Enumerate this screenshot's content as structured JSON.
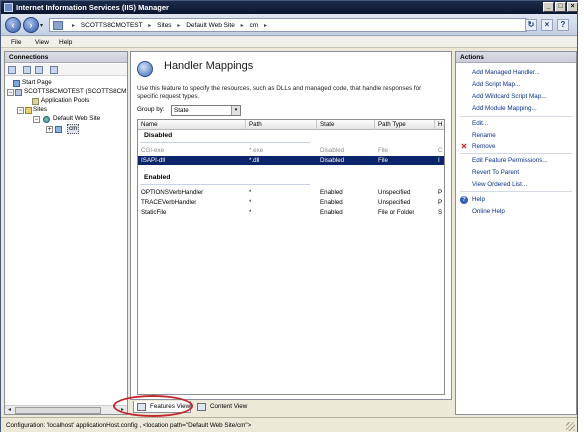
{
  "window": {
    "title": "Internet Information Services (IIS) Manager"
  },
  "address": {
    "crumbs": [
      "SCOTTS8CMOTEST",
      "Sites",
      "Default Web Site",
      "cm"
    ]
  },
  "menu": [
    "File",
    "View",
    "Help"
  ],
  "connections": {
    "header": "Connections",
    "tree": [
      {
        "label": "Start Page"
      },
      {
        "label": "SCOTTS8CMOTEST (SCOTTS8CM"
      },
      {
        "label": "Application Pools"
      },
      {
        "label": "Sites"
      },
      {
        "label": "Default Web Site"
      },
      {
        "label": "cm"
      }
    ]
  },
  "main": {
    "title": "Handler Mappings",
    "description": "Use this feature to specify the resources, such as DLLs and managed code, that handle responses for specific request types.",
    "group_by_label": "Group by:",
    "group_by_value": "State",
    "columns": [
      "Name",
      "Path",
      "State",
      "Path Type",
      "H"
    ],
    "groups": [
      {
        "title": "Disabled",
        "rows": [
          {
            "name": "CGI-exe",
            "path": "*.exe",
            "state": "Disabled",
            "type": "File",
            "h": "C"
          },
          {
            "name": "ISAPI-dll",
            "path": "*.dll",
            "state": "Disabled",
            "type": "File",
            "h": "I"
          }
        ]
      },
      {
        "title": "Enabled",
        "rows": [
          {
            "name": "OPTIONSVerbHandler",
            "path": "*",
            "state": "Enabled",
            "type": "Unspecified",
            "h": "P"
          },
          {
            "name": "TRACEVerbHandler",
            "path": "*",
            "state": "Enabled",
            "type": "Unspecified",
            "h": "P"
          },
          {
            "name": "StaticFile",
            "path": "*",
            "state": "Enabled",
            "type": "File or Folder",
            "h": "S"
          }
        ]
      }
    ]
  },
  "tabs": {
    "features": "Features View",
    "content": "Content View"
  },
  "actions": {
    "header": "Actions",
    "add_managed": "Add Managed Handler...",
    "add_script": "Add Script Map...",
    "add_wildcard": "Add Wildcard Script Map...",
    "add_module": "Add Module Mapping...",
    "edit": "Edit...",
    "rename": "Rename",
    "remove": "Remove",
    "edit_permissions": "Edit Feature Permissions...",
    "revert": "Revert To Parent",
    "view_ordered": "View Ordered List...",
    "help": "Help",
    "online_help": "Online Help"
  },
  "status": "Configuration: 'localhost' applicationHost.config , <location path=\"Default Web Site/cm\">",
  "colors": {
    "selection": "#0b246a",
    "link": "#0a2f8a",
    "highlight_ring": "#c0282e"
  }
}
